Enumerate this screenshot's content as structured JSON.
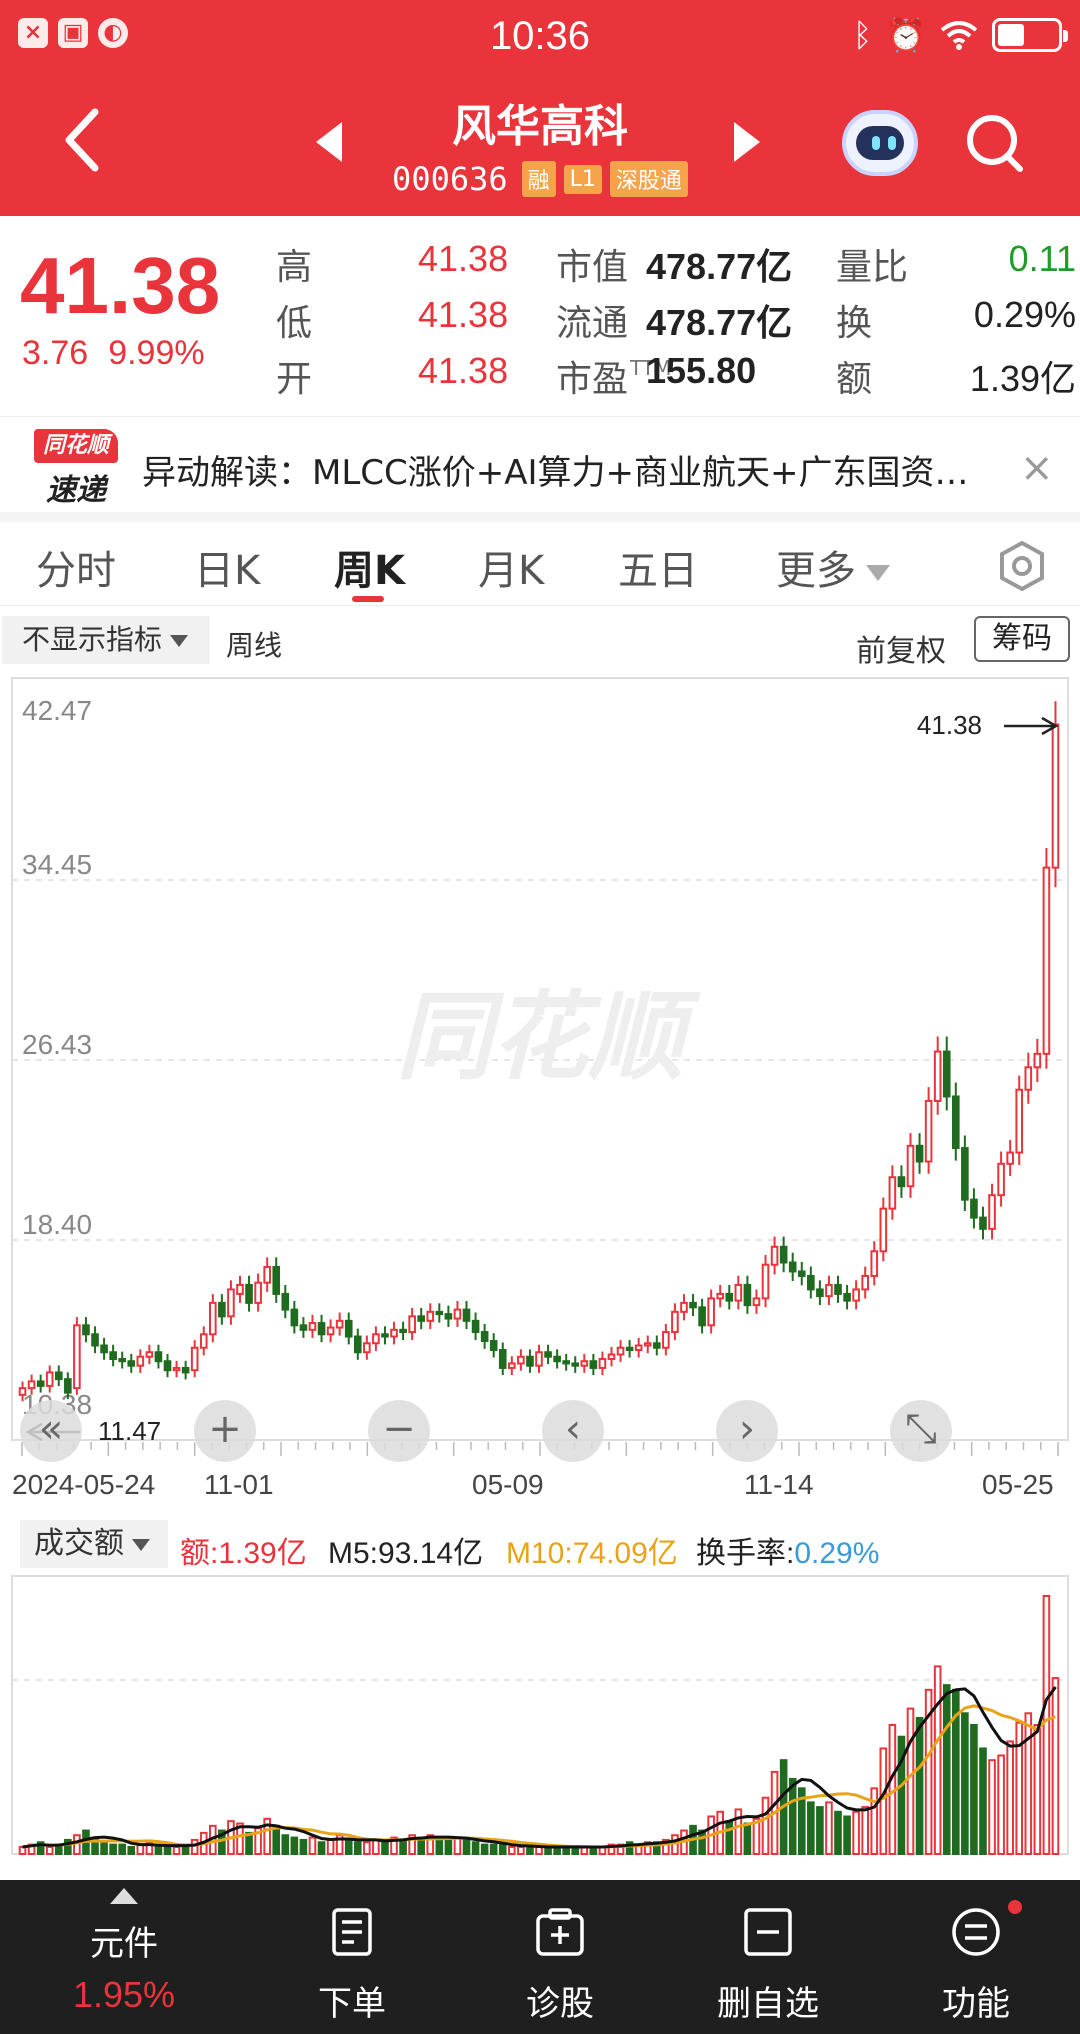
{
  "status_bar": {
    "time": "10:36",
    "left_icons": [
      "x-app-icon",
      "sim-icon",
      "browser-icon"
    ],
    "right_icons": [
      "bluetooth-icon",
      "alarm-icon",
      "wifi-icon",
      "battery-icon"
    ],
    "battery_level": 0.45
  },
  "header": {
    "stock_name": "风华高科",
    "stock_code": "000636",
    "tags": [
      "融",
      "L1",
      "深股通"
    ],
    "bg_color": "#e9343b"
  },
  "quote": {
    "price": "41.38",
    "change": "3.76",
    "change_pct": "9.99%",
    "rows": [
      [
        {
          "label": "高",
          "value": "41.38",
          "color": "red"
        },
        {
          "label": "市值",
          "value": "478.77亿",
          "color": "dark"
        },
        {
          "label": "量比",
          "value": "0.11",
          "color": "green"
        }
      ],
      [
        {
          "label": "低",
          "value": "41.38",
          "color": "red"
        },
        {
          "label": "流通",
          "value": "478.77亿",
          "color": "dark"
        },
        {
          "label": "换",
          "value": "0.29%",
          "color": "dark"
        }
      ],
      [
        {
          "label": "开",
          "value": "41.38",
          "color": "red"
        },
        {
          "label": "市盈",
          "sup": "TTM",
          "value": "155.80",
          "color": "dark"
        },
        {
          "label": "额",
          "value": "1.39亿",
          "color": "dark"
        }
      ]
    ]
  },
  "news": {
    "logo_top": "同花顺",
    "logo_bottom": "速递",
    "text": "异动解读：MLCC涨价+AI算力+商业航天+广东国资…",
    "close": "×"
  },
  "tabs": [
    {
      "label": "分时",
      "active": false
    },
    {
      "label": "日K",
      "active": false
    },
    {
      "label": "周K",
      "active": true
    },
    {
      "label": "月K",
      "active": false
    },
    {
      "label": "五日",
      "active": false
    },
    {
      "label": "更多",
      "active": false
    }
  ],
  "chart_toolbar": {
    "indicator": "不显示指标",
    "ma_label": "周线",
    "fq_label": "前复权",
    "chip_label": "筹码"
  },
  "chart_data": {
    "type": "candlestick",
    "y_axis_labels": [
      "42.47",
      "34.45",
      "26.43",
      "18.40",
      "10.38"
    ],
    "ylim": [
      10.38,
      42.47
    ],
    "x_axis_labels": [
      "2024-05-24",
      "11-01",
      "05-09",
      "11-14",
      "05-25"
    ],
    "annotations": {
      "high_label": "41.38",
      "low_label": "11.47"
    },
    "watermark": "同花顺",
    "close": [
      11.8,
      12.1,
      11.9,
      12.5,
      12.2,
      11.6,
      14.6,
      14.2,
      13.7,
      13.4,
      13.1,
      13.0,
      12.8,
      13.2,
      13.4,
      13.0,
      12.6,
      12.7,
      12.5,
      13.6,
      14.2,
      15.6,
      15.0,
      16.2,
      16.4,
      15.6,
      16.5,
      17.2,
      16.0,
      15.3,
      14.6,
      14.4,
      14.7,
      14.2,
      14.5,
      14.8,
      14.1,
      13.4,
      13.8,
      14.2,
      14.1,
      14.4,
      14.3,
      15.0,
      14.8,
      15.2,
      15.1,
      14.9,
      15.3,
      14.8,
      14.3,
      13.9,
      13.5,
      12.7,
      12.9,
      13.2,
      12.8,
      13.4,
      13.2,
      13.0,
      12.9,
      12.8,
      13.0,
      12.7,
      13.1,
      13.3,
      13.6,
      13.5,
      13.7,
      13.8,
      13.6,
      14.3,
      15.2,
      15.6,
      15.4,
      14.6,
      15.8,
      16.0,
      15.7,
      16.4,
      15.5,
      15.8,
      17.3,
      18.1,
      17.4,
      17.0,
      16.8,
      16.2,
      15.9,
      16.4,
      16.0,
      15.7,
      16.2,
      16.8,
      17.9,
      19.8,
      21.2,
      20.8,
      22.6,
      21.9,
      24.6,
      26.8,
      24.8,
      22.5,
      20.2,
      19.4,
      18.9,
      20.4,
      21.8,
      22.3,
      25.1,
      26.1,
      26.7,
      35.0,
      41.38
    ],
    "open": [
      11.5,
      11.8,
      12.1,
      11.9,
      12.5,
      12.2,
      11.8,
      14.6,
      14.2,
      13.7,
      13.4,
      13.1,
      13.0,
      12.8,
      13.2,
      13.4,
      13.0,
      12.6,
      12.7,
      12.6,
      13.6,
      14.2,
      15.6,
      15.0,
      16.0,
      16.4,
      15.6,
      16.5,
      17.2,
      16.0,
      15.3,
      14.6,
      14.4,
      14.7,
      14.2,
      14.5,
      14.8,
      14.1,
      13.4,
      13.8,
      14.2,
      14.1,
      14.4,
      14.3,
      15.0,
      14.8,
      15.2,
      15.1,
      14.9,
      15.3,
      14.8,
      14.3,
      13.9,
      13.5,
      12.7,
      12.9,
      13.2,
      12.8,
      13.4,
      13.2,
      13.0,
      12.9,
      12.8,
      13.0,
      12.7,
      13.1,
      13.3,
      13.6,
      13.5,
      13.7,
      13.8,
      13.6,
      14.3,
      15.2,
      15.6,
      15.4,
      14.6,
      15.8,
      16.0,
      15.7,
      16.4,
      15.5,
      15.8,
      17.3,
      18.1,
      17.4,
      17.0,
      16.8,
      16.2,
      15.9,
      16.4,
      16.0,
      15.7,
      16.2,
      16.8,
      17.9,
      19.8,
      21.2,
      20.8,
      22.6,
      21.9,
      24.6,
      26.8,
      24.8,
      22.5,
      20.2,
      19.4,
      18.9,
      20.4,
      21.8,
      22.3,
      25.1,
      26.1,
      26.7,
      35.0
    ],
    "volume": [
      3,
      4,
      5,
      3,
      4,
      6,
      8,
      10,
      7,
      5,
      4,
      4,
      3,
      4,
      5,
      3,
      3,
      3,
      4,
      6,
      9,
      12,
      10,
      14,
      13,
      9,
      11,
      15,
      12,
      8,
      7,
      6,
      7,
      5,
      6,
      8,
      6,
      5,
      5,
      6,
      6,
      7,
      6,
      8,
      7,
      8,
      7,
      6,
      7,
      6,
      5,
      4,
      4,
      4,
      3,
      3,
      3,
      3,
      3,
      3,
      3,
      3,
      3,
      3,
      3,
      4,
      4,
      5,
      4,
      5,
      5,
      6,
      8,
      10,
      12,
      10,
      16,
      18,
      14,
      19,
      13,
      15,
      24,
      35,
      40,
      32,
      28,
      22,
      20,
      22,
      18,
      16,
      18,
      20,
      28,
      45,
      55,
      50,
      62,
      58,
      70,
      80,
      72,
      70,
      60,
      55,
      45,
      40,
      42,
      48,
      56,
      60,
      55,
      110,
      75
    ],
    "ma5_label": "M5:93.14亿",
    "ma10_label": "M10:74.09亿"
  },
  "volume_header": {
    "select": "成交额",
    "amount": "额:1.39亿",
    "m5": "M5:93.14亿",
    "m10": "M10:74.09亿",
    "turnover_label": "换手率:",
    "turnover_value": "0.29%"
  },
  "controls": [
    "«",
    "+",
    "−",
    "‹",
    "›",
    "⤡"
  ],
  "bottom_nav": {
    "first": {
      "label": "元件",
      "pct": "1.95%"
    },
    "items": [
      {
        "label": "下单",
        "icon": "order-icon"
      },
      {
        "label": "诊股",
        "icon": "diagnose-icon"
      },
      {
        "label": "删自选",
        "icon": "remove-watchlist-icon"
      },
      {
        "label": "功能",
        "icon": "function-icon"
      }
    ]
  },
  "colors": {
    "up": "#e9343b",
    "down": "#1f6b1f",
    "ma5": "#111111",
    "ma10": "#e8a317",
    "turnover": "#3a9bdc"
  }
}
